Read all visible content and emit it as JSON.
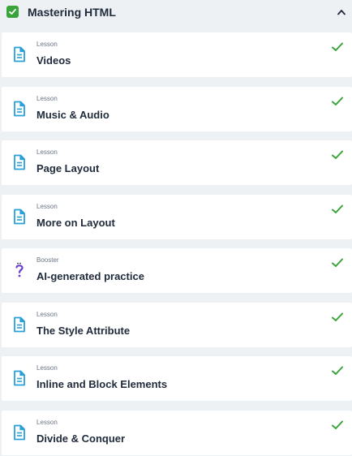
{
  "section": {
    "title": "Mastering HTML",
    "completed": true,
    "expanded": true,
    "accent_color": "#3aa43a"
  },
  "items": [
    {
      "kind": "Lesson",
      "name": "Videos",
      "icon": "lesson-document-icon",
      "completed": true
    },
    {
      "kind": "Lesson",
      "name": "Music & Audio",
      "icon": "lesson-document-icon",
      "completed": true
    },
    {
      "kind": "Lesson",
      "name": "Page Layout",
      "icon": "lesson-document-icon",
      "completed": true
    },
    {
      "kind": "Lesson",
      "name": "More on Layout",
      "icon": "lesson-document-icon",
      "completed": true
    },
    {
      "kind": "Booster",
      "name": "AI-generated practice",
      "icon": "booster-question-icon",
      "completed": true
    },
    {
      "kind": "Lesson",
      "name": "The Style Attribute",
      "icon": "lesson-document-icon",
      "completed": true
    },
    {
      "kind": "Lesson",
      "name": "Inline and Block Elements",
      "icon": "lesson-document-icon",
      "completed": true
    },
    {
      "kind": "Lesson",
      "name": "Divide & Conquer",
      "icon": "lesson-document-icon",
      "completed": true
    }
  ]
}
